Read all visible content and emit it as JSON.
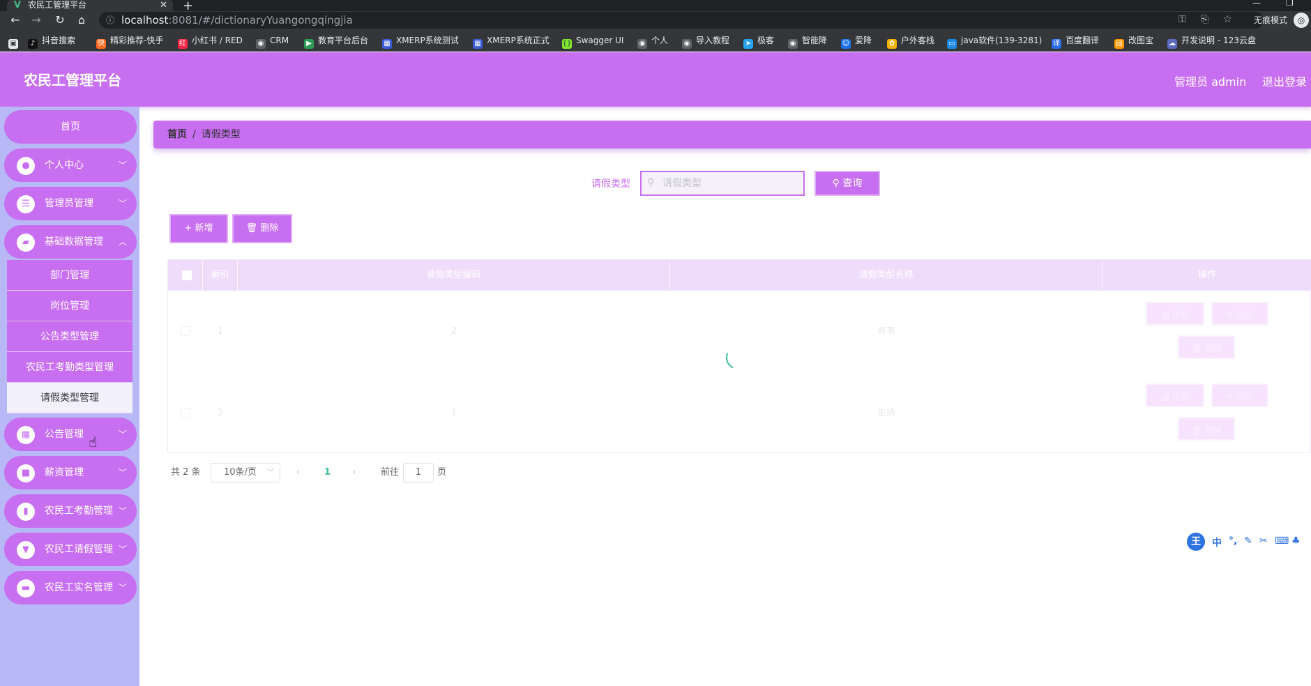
{
  "browser": {
    "tab_title": "农民工管理平台",
    "url_host": "localhost",
    "url_path": ":8081/#/dictionaryYuangongqingjia",
    "incognito_label": "无痕模式",
    "bookmarks": [
      {
        "label": "抖音搜索",
        "icon": "tiktok-icon"
      },
      {
        "label": "精彩推荐-快手",
        "icon": "kuaishou-icon"
      },
      {
        "label": "小红书 / RED",
        "icon": "xiaohongshu-icon"
      },
      {
        "label": "CRM",
        "icon": "globe-icon"
      },
      {
        "label": "教育平台后台",
        "icon": "platform-icon"
      },
      {
        "label": "XMERP系统测试",
        "icon": "erp-icon"
      },
      {
        "label": "XMERP系统正式",
        "icon": "erp-icon"
      },
      {
        "label": "Swagger UI",
        "icon": "swagger-icon"
      },
      {
        "label": "个人",
        "icon": "globe-icon"
      },
      {
        "label": "导入教程",
        "icon": "globe-icon"
      },
      {
        "label": "极客",
        "icon": "telegram-icon"
      },
      {
        "label": "智能降",
        "icon": "globe-icon"
      },
      {
        "label": "爱降",
        "icon": "smile-icon"
      },
      {
        "label": "户外客栈",
        "icon": "outdoor-icon"
      },
      {
        "label": "java软件(139-3281)",
        "icon": "tv-icon"
      },
      {
        "label": "百度翻译",
        "icon": "translate-icon"
      },
      {
        "label": "改图宝",
        "icon": "image-icon"
      },
      {
        "label": "开发说明 - 123云盘",
        "icon": "cloud-icon"
      }
    ]
  },
  "header": {
    "app_title": "农民工管理平台",
    "admin_label": "管理员 admin",
    "logout_label": "退出登录"
  },
  "sidebar": {
    "home": "首页",
    "menus": [
      {
        "label": "个人中心",
        "icon": "user-icon"
      },
      {
        "label": "管理员管理",
        "icon": "sliders-icon"
      },
      {
        "label": "基础数据管理",
        "icon": "ticket-icon"
      },
      {
        "label": "公告管理",
        "icon": "grid-icon"
      },
      {
        "label": "薪资管理",
        "icon": "briefcase-icon"
      },
      {
        "label": "农民工考勤管理",
        "icon": "clipboard-icon"
      },
      {
        "label": "农民工请假管理",
        "icon": "stamp-icon"
      },
      {
        "label": "农民工实名管理",
        "icon": "monitor-icon"
      }
    ],
    "submenu": [
      "部门管理",
      "岗位管理",
      "公告类型管理",
      "农民工考勤类型管理",
      "请假类型管理"
    ]
  },
  "breadcrumb": {
    "home": "首页",
    "sep": "/",
    "current": "请假类型"
  },
  "search": {
    "label": "请假类型",
    "placeholder": "请假类型",
    "query_button": "查询"
  },
  "actions": {
    "add": "新增",
    "delete": "删除"
  },
  "table": {
    "columns": [
      "索引",
      "请假类型编码",
      "请假类型名称",
      "操作"
    ],
    "rows": [
      {
        "index": "1",
        "code": "2",
        "name": "有事"
      },
      {
        "index": "2",
        "code": "1",
        "name": "生病"
      }
    ],
    "row_actions": {
      "detail": "详情",
      "edit": "修改",
      "delete": "删除"
    }
  },
  "pagination": {
    "total": "共 2 条",
    "page_size": "10条/页",
    "current_page": "1",
    "goto_prefix": "前往",
    "goto_value": "1",
    "goto_suffix": "页"
  },
  "colors": {
    "brand": "#c86ef0",
    "sidebar_bg": "#b7b8f5",
    "spinner": "#3cbba2"
  }
}
